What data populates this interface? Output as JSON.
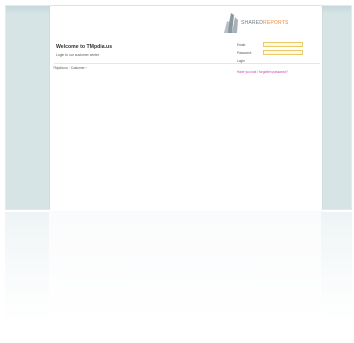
{
  "logo": {
    "text_main": "SHARED",
    "text_accent": "REPORTS"
  },
  "page": {
    "welcome_title": "Welcome to TMpdia.us",
    "subtext": "Login to our customer center",
    "breadcrumb": "TMpdia.us · Customer ›"
  },
  "login_form": {
    "email_label": "Email:",
    "password_label": "Password:",
    "login_label": "Login",
    "link_text": "Have you lost / forgotten password?"
  },
  "colors": {
    "card_background": "#d6e4e6",
    "input_border": "#e9c96a",
    "input_fill": "#fff9e0",
    "link": "#c23db7",
    "logo_accent": "#e88a3a"
  }
}
